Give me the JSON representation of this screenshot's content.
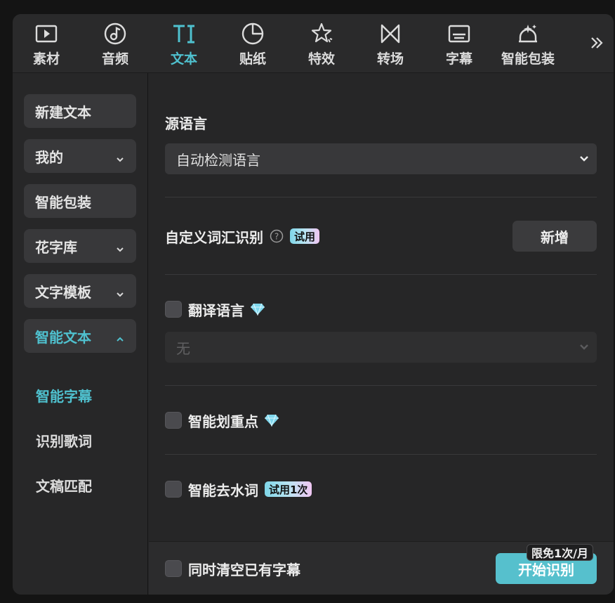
{
  "tabs": [
    {
      "label": "素材",
      "icon": "media-play-icon"
    },
    {
      "label": "音频",
      "icon": "audio-note-icon"
    },
    {
      "label": "文本",
      "icon": "text-ti-icon",
      "active": true
    },
    {
      "label": "贴纸",
      "icon": "sticker-icon"
    },
    {
      "label": "特效",
      "icon": "effects-star-icon"
    },
    {
      "label": "转场",
      "icon": "transition-bowtie-icon"
    },
    {
      "label": "字幕",
      "icon": "subtitle-icon"
    },
    {
      "label": "智能包装",
      "icon": "smart-package-icon"
    }
  ],
  "accent_color": "#4fc1cf",
  "sidebar": {
    "items": [
      {
        "label": "新建文本"
      },
      {
        "label": "我的"
      },
      {
        "label": "智能包装"
      },
      {
        "label": "花字库"
      },
      {
        "label": "文字模板"
      },
      {
        "label": "智能文本"
      }
    ],
    "sub_items": [
      {
        "label": "智能字幕"
      },
      {
        "label": "识别歌词"
      },
      {
        "label": "文稿匹配"
      }
    ]
  },
  "main": {
    "source_language": {
      "label": "源语言",
      "value": "自动检测语言"
    },
    "custom_vocab": {
      "label": "自定义词汇识别",
      "badge": "试用",
      "button": "新增"
    },
    "translate": {
      "label": "翻译语言",
      "value": "无"
    },
    "highlight": {
      "label": "智能划重点"
    },
    "remove_fillers": {
      "label": "智能去水词",
      "badge": "试用1次"
    }
  },
  "footer": {
    "clear_label": "同时清空已有字幕",
    "start_button": "开始识别",
    "limit_badge": "限免1次/月"
  }
}
